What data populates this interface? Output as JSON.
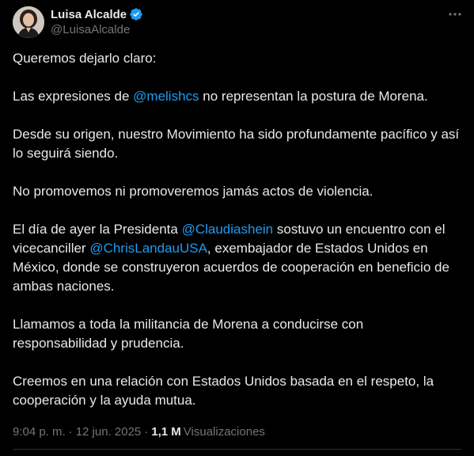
{
  "author": {
    "display_name": "Luisa Alcalde",
    "handle": "@LuisaAlcalde",
    "verified_color": "#1d9bf0"
  },
  "icons": {
    "more": "more-horizontal-icon",
    "verified": "verified-badge-icon"
  },
  "tweet": {
    "p1": "Queremos dejarlo claro:",
    "p2_pre": "Las expresiones de ",
    "p2_mention": "@melishcs",
    "p2_post": " no representan la postura de Morena.",
    "p3": "Desde su origen, nuestro Movimiento ha sido profundamente pacífico y así lo seguirá siendo.",
    "p4": "No promovemos ni promoveremos jamás actos de violencia.",
    "p5_a": "El día de ayer la Presidenta ",
    "p5_mention1": "@Claudiashein",
    "p5_b": " sostuvo un encuentro con el vicecanciller ",
    "p5_mention2": "@ChrisLandauUSA",
    "p5_c": ", exembajador de Estados Unidos en México, donde se construyeron acuerdos de cooperación en beneficio de ambas naciones.",
    "p6": "Llamamos a toda la militancia de Morena a conducirse con responsabilidad y prudencia.",
    "p7": "Creemos en una relación con Estados Unidos basada en el respeto, la cooperación y la ayuda mutua."
  },
  "meta": {
    "time": "9:04 p. m.",
    "separator": "·",
    "date": "12 jun. 2025",
    "views_count": "1,1 M",
    "views_label": "Visualizaciones"
  },
  "colors": {
    "background": "#000000",
    "text": "#e7e9ea",
    "secondary": "#71767b",
    "link": "#1d9bf0"
  }
}
